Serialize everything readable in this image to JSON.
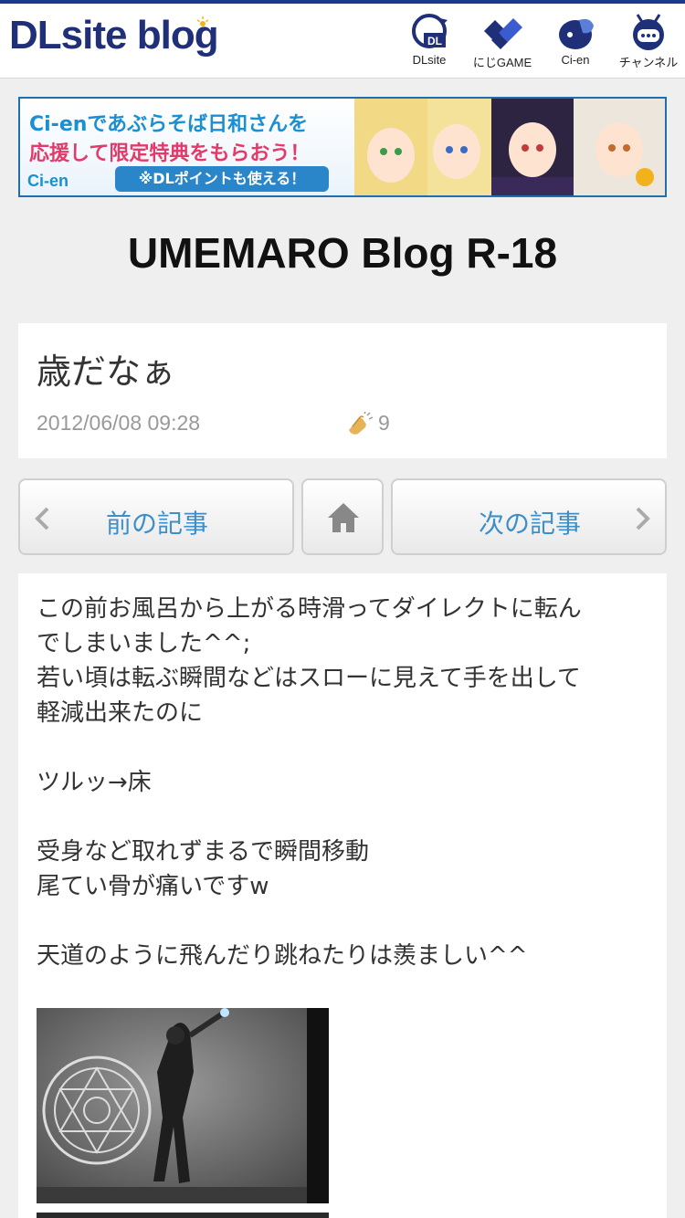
{
  "header": {
    "logo_main": "DLsite",
    "logo_sub": "blog",
    "nav": [
      {
        "label": "DLsite",
        "icon": "dlsite-icon"
      },
      {
        "label": "にじGAME",
        "icon": "nijigame-icon"
      },
      {
        "label": "Ci-en",
        "icon": "cien-icon"
      },
      {
        "label": "チャンネル",
        "icon": "channel-icon"
      }
    ]
  },
  "banner": {
    "line1": "Ci-enであぶらそば日和さんを",
    "line2": "応援して限定特典をもらおう！",
    "brand": "Ci-en",
    "note": "※DLポイントも使える！"
  },
  "blog": {
    "title": "UMEMARO Blog R-18"
  },
  "post": {
    "title": "歳だなぁ",
    "date": "2012/06/08 09:28",
    "clap_count": "9",
    "body": [
      "この前お風呂から上がる時滑ってダイレクトに転ん",
      "でしまいました^^;",
      "若い頃は転ぶ瞬間などはスローに見えて手を出して",
      "軽減出来たのに",
      "",
      "ツルッ→床",
      "",
      "受身など取れずまるで瞬間移動",
      "尾てい骨が痛いですw",
      "",
      "天道のように飛んだり跳ねたりは羨ましい^^"
    ]
  },
  "navigation": {
    "prev_label": "前の記事",
    "next_label": "次の記事"
  },
  "colors": {
    "brand_navy": "#1f2f78",
    "link_blue": "#3d8fc9",
    "banner_blue": "#1a8fd2",
    "banner_pink": "#e23b6a"
  }
}
